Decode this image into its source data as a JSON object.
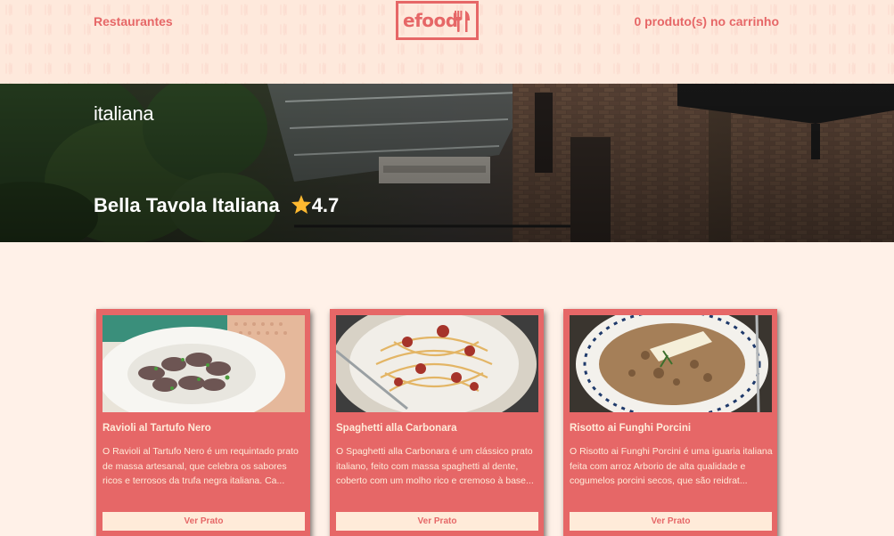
{
  "header": {
    "restaurants_link": "Restaurantes",
    "logo_text": "efood",
    "cart_text": "0 produto(s) no carrinho"
  },
  "banner": {
    "cuisine": "italiana",
    "restaurant_name": "Bella Tavola Italiana",
    "rating": "4.7"
  },
  "colors": {
    "primary": "#E66767",
    "light": "#FFEBD9",
    "background": "#FFF1E8",
    "star": "#FFB930"
  },
  "products": [
    {
      "title": "Ravioli al Tartufo Nero",
      "description": "O Ravioli al Tartufo Nero é um requintado prato de massa artesanal, que celebra os sabores ricos e terrosos da trufa negra italiana. Ca...",
      "button": "Ver Prato"
    },
    {
      "title": "Spaghetti alla Carbonara",
      "description": "O Spaghetti alla Carbonara é um clássico prato italiano, feito com massa spaghetti al dente, coberto com um molho rico e cremoso à base...",
      "button": "Ver Prato"
    },
    {
      "title": "Risotto ai Funghi Porcini",
      "description": "O Risotto ai Funghi Porcini é uma iguaria italiana feita com arroz Arborio de alta qualidade e cogumelos porcini secos, que são reidrat...",
      "button": "Ver Prato"
    }
  ]
}
